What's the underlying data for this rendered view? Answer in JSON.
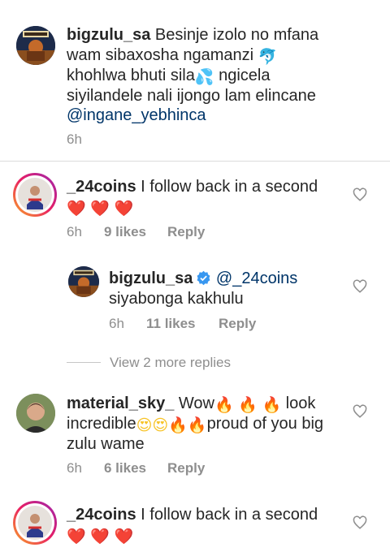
{
  "comments": [
    {
      "username": "bigzulu_sa",
      "text_parts": [
        "Besinje izolo no mfana wam sibaxosha ngamanzi ",
        "🐬",
        " khohlwa bhuti sila",
        "💦",
        " ngicela siyilandele nali ijongo lam elincane "
      ],
      "mention": "@ingane_yebhinca",
      "time": "6h",
      "avatar_label": "BIG ZULU"
    },
    {
      "username": "_24coins",
      "text": "I follow back in a second",
      "emojis": [
        "❤️",
        "❤️",
        "❤️"
      ],
      "time": "6h",
      "likes": "9 likes",
      "reply_label": "Reply"
    },
    {
      "username": "bigzulu_sa",
      "mention": "@_24coins",
      "text": "siyabonga kakhulu",
      "time": "6h",
      "likes": "11 likes",
      "reply_label": "Reply",
      "verified": true,
      "avatar_label": "BIG ZULU"
    },
    {
      "username": "material_sky_",
      "text_a": "Wow",
      "text_b": " look incredible",
      "text_c": "proud of you big zulu wame",
      "time": "6h",
      "likes": "6 likes",
      "reply_label": "Reply"
    },
    {
      "username": "_24coins",
      "text": "I follow back in a second",
      "emojis": [
        "❤️",
        "❤️",
        "❤️"
      ]
    }
  ],
  "view_more_replies": "View 2 more replies",
  "colors": {
    "text": "#262626",
    "secondary": "#8e8e8e",
    "mention": "#003569",
    "verified": "#3897f0",
    "heart": "#e0102f"
  }
}
